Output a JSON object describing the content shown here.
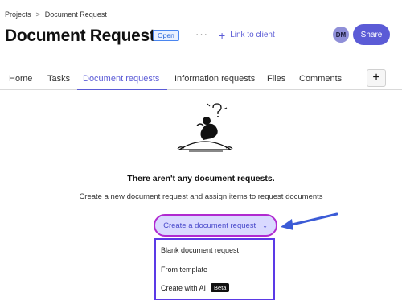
{
  "breadcrumb": {
    "parent": "Projects",
    "separator": ">",
    "current": "Document Request"
  },
  "header": {
    "title": "Document Request",
    "status": "Open",
    "more_label": "···",
    "link_client_label": "Link to client",
    "avatar_initials": "DM",
    "share_label": "Share"
  },
  "tabs": [
    {
      "label": "Home"
    },
    {
      "label": "Tasks"
    },
    {
      "label": "Document requests",
      "active": true
    },
    {
      "label": "Information requests"
    },
    {
      "label": "Files"
    },
    {
      "label": "Comments"
    }
  ],
  "tab_add_label": "+",
  "empty_state": {
    "title": "There aren't any document requests.",
    "description": "Create a new document request and assign items to request documents"
  },
  "create_button": {
    "label": "Create a document request"
  },
  "dropdown": {
    "items": [
      {
        "label": "Blank document request"
      },
      {
        "label": "From template"
      },
      {
        "label": "Create with AI",
        "badge": "Beta"
      }
    ]
  },
  "colors": {
    "accent": "#5b5bd6",
    "highlight_outline": "#b12ad0",
    "annotation_arrow": "#3b5bd6",
    "status_border": "#4a86f0"
  }
}
